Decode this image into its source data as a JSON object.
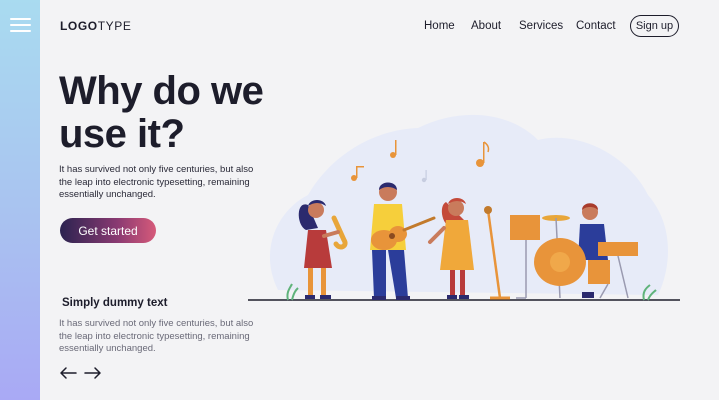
{
  "header": {
    "logo_bold": "LOGO",
    "logo_light": "TYPE",
    "nav": [
      "Home",
      "About",
      "Services",
      "Contact"
    ],
    "signup_label": "Sign up"
  },
  "hero": {
    "title": "Why do we use it?",
    "text": "It has survived not only five centuries, but also the leap into electronic typesetting, remaining essentially unchanged.",
    "cta_label": "Get started"
  },
  "section": {
    "title": "Simply dummy text",
    "text": "It has survived not only five centuries, but also the leap into electronic typesetting, remaining essentially unchanged."
  },
  "icons": {
    "menu": "hamburger-icon",
    "prev": "arrow-left-icon",
    "next": "arrow-right-icon"
  },
  "colors": {
    "sidebar_top": "#a9dbf0",
    "sidebar_bottom": "#a9a9f5",
    "cta_start": "#2b2350",
    "cta_end": "#d65a7a",
    "text_dark": "#1d1d2b"
  }
}
